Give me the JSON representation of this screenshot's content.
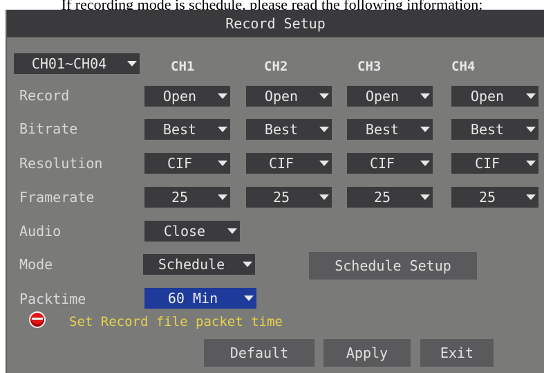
{
  "page_caption": "If recording mode is schedule, please read the following information:",
  "dialog": {
    "title": "Record Setup",
    "channel_group": "CH01~CH04",
    "channel_headers": [
      "CH1",
      "CH2",
      "CH3",
      "CH4"
    ],
    "labels": {
      "record": "Record",
      "bitrate": "Bitrate",
      "resolution": "Resolution",
      "framerate": "Framerate",
      "audio": "Audio",
      "mode": "Mode",
      "packtime": "Packtime"
    },
    "record": [
      "Open",
      "Open",
      "Open",
      "Open"
    ],
    "bitrate": [
      "Best",
      "Best",
      "Best",
      "Best"
    ],
    "resolution": [
      "CIF",
      "CIF",
      "CIF",
      "CIF"
    ],
    "framerate": [
      "25",
      "25",
      "25",
      "25"
    ],
    "audio": "Close",
    "mode": "Schedule",
    "schedule_setup_label": "Schedule Setup",
    "packtime": "60 Min",
    "hint": "Set Record file packet time",
    "buttons": {
      "default": "Default",
      "apply": "Apply",
      "exit": "Exit"
    },
    "colors": {
      "background": "#7a7a78",
      "title_bar": "#3a3a3c",
      "dropdown": "#3b3b3d",
      "focused_dropdown": "#1e3a9a",
      "hint_text": "#e6d24a",
      "hint_icon": "#e01818"
    },
    "icons": {
      "dropdown_arrow": "chevron-down-icon",
      "hint": "red-dot-icon"
    }
  }
}
